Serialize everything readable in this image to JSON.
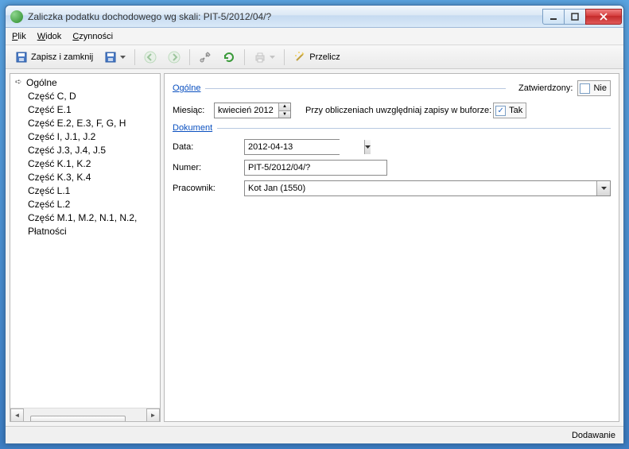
{
  "window": {
    "title": "Zaliczka podatku dochodowego wg skali: PIT-5/2012/04/?"
  },
  "menu": {
    "file": "Plik",
    "view": "Widok",
    "actions": "Czynności"
  },
  "toolbar": {
    "save_close": "Zapisz i zamknij",
    "recalc": "Przelicz"
  },
  "tree": {
    "root": "Ogólne",
    "items": [
      "Część C, D",
      "Część E.1",
      "Część E.2, E.3, F, G, H",
      "Część I, J.1, J.2",
      "Część J.3, J.4, J.5",
      "Część K.1, K.2",
      "Część K.3, K.4",
      "Część L.1",
      "Część L.2",
      "Część M.1, M.2, N.1, N.2,",
      "Płatności"
    ]
  },
  "general": {
    "header": "Ogólne",
    "approved_label": "Zatwierdzony:",
    "approved_value": "Nie",
    "month_label": "Miesiąc:",
    "month_value": "kwiecień 2012",
    "buffer_label": "Przy obliczeniach uwzględniaj zapisy w buforze:",
    "buffer_value": "Tak"
  },
  "document": {
    "header": "Dokument",
    "date_label": "Data:",
    "date_value": "2012-04-13",
    "number_label": "Numer:",
    "number_value": "PIT-5/2012/04/?",
    "worker_label": "Pracownik:",
    "worker_value": "Kot Jan (1550)"
  },
  "status": {
    "mode": "Dodawanie"
  }
}
